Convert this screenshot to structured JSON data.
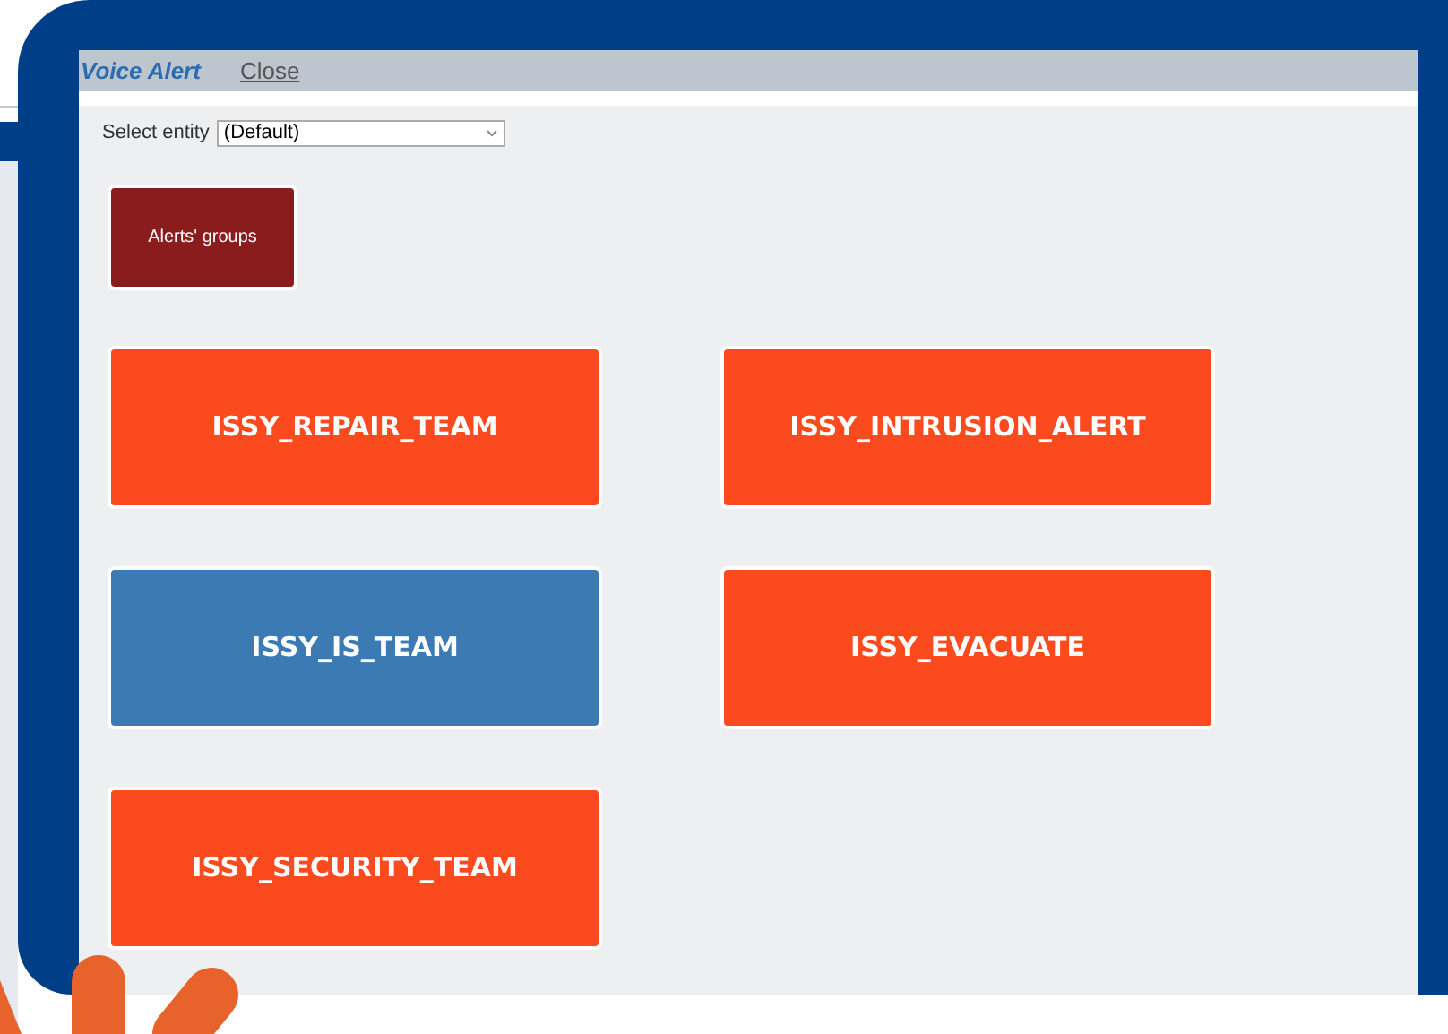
{
  "header": {
    "title": "Voice Alert",
    "close_link": "Close"
  },
  "entity_select": {
    "label": "Select entity",
    "value": "(Default)"
  },
  "groups_button": {
    "label": "Alerts' groups"
  },
  "alerts": [
    {
      "label": "ISSY_REPAIR_TEAM",
      "color": "#fc4a1f"
    },
    {
      "label": "ISSY_INTRUSION_ALERT",
      "color": "#fc4a1f"
    },
    {
      "label": "ISSY_IS_TEAM",
      "color": "#3b7ab3"
    },
    {
      "label": "ISSY_EVACUATE",
      "color": "#fc4a1f"
    },
    {
      "label": "ISSY_SECURITY_TEAM",
      "color": "#fc4a1f"
    }
  ]
}
